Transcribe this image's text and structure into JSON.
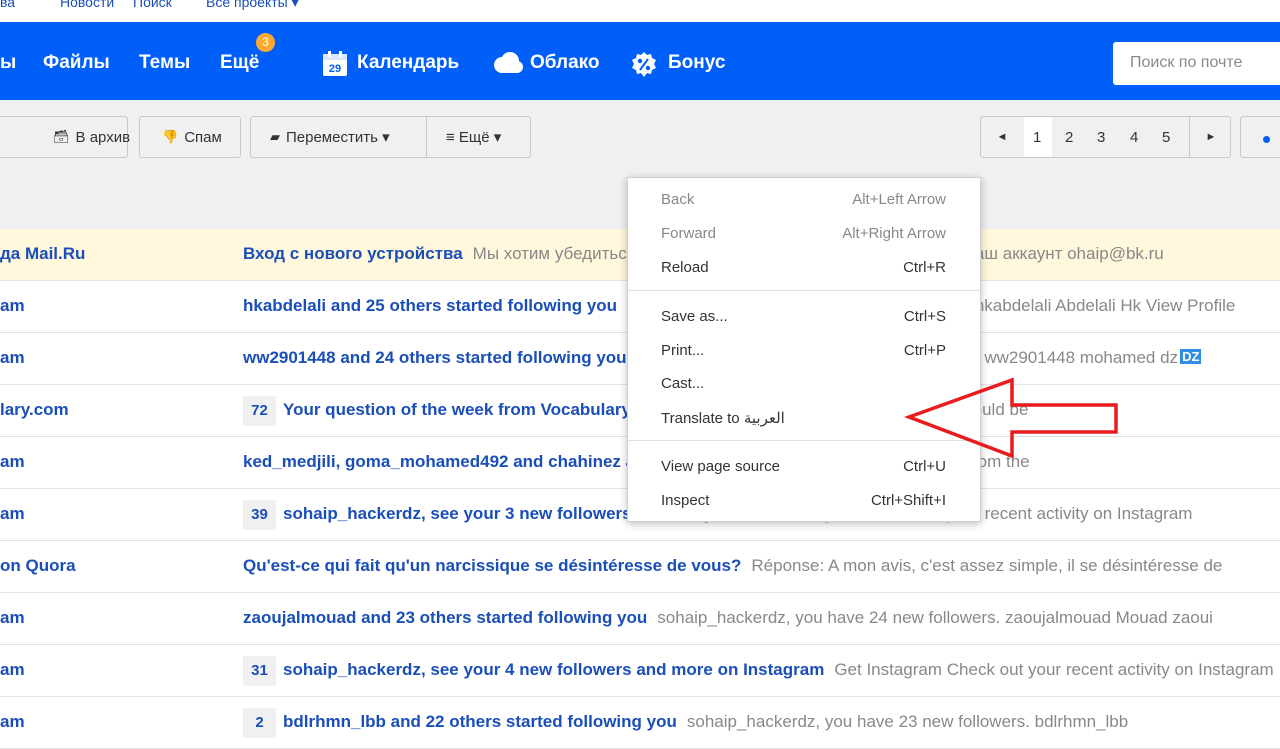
{
  "portal": {
    "items": [
      "ва",
      "Новости",
      "Поиск",
      "Все проекты ▾"
    ]
  },
  "header": {
    "nav": [
      "ы",
      "Файлы",
      "Темы",
      "Ещё"
    ],
    "more_badge": "3",
    "calendar_day": "29",
    "calendar": "Календарь",
    "cloud": "Облако",
    "bonus": "Бонус",
    "search_placeholder": "Поиск по почте",
    "colors": {
      "header_bg": "#005ff9",
      "badge": "#ffa930"
    }
  },
  "toolbar": {
    "archive": "В архив",
    "spam": "Спам",
    "move": "Переместить ▾",
    "more": "≡ Ещё ▾",
    "pages": [
      "1",
      "2",
      "3",
      "4",
      "5"
    ],
    "current_page": "1",
    "prev_icon": "◄",
    "next_icon": "►"
  },
  "messages": [
    {
      "sender": "да Mail.Ru",
      "count": "",
      "subject": "Вход с нового устройства",
      "snippet": "Мы хотим убедиться, что вы в безопасности. Здравствуйте! В ваш аккаунт ohaip@bk.ru",
      "unread_highlight": true
    },
    {
      "sender": "am",
      "count": "",
      "subject": "hkabdelali and 25 others started following you",
      "snippet": "sohaip_hackerdz, you have 25 new followers. hkabdelali Abdelali Hk View Profile"
    },
    {
      "sender": "am",
      "count": "",
      "subject": "ww2901448 and 24 others started following you",
      "snippet": "sohaip_hackerdz, you have 24 new followers. ww2901448 mohamed dz",
      "badge": "DZ"
    },
    {
      "sender": "lary.com",
      "count": "72",
      "subject": "Your question of the week from Vocabulary.com",
      "snippet": "Your question of the week: Yes, there could be"
    },
    {
      "sender": "am",
      "count": "",
      "subject": "ked_medjili, goma_mohamed492 and chahinez and others",
      "snippet": "See what you may have missed from the"
    },
    {
      "sender": "am",
      "count": "39",
      "subject": "sohaip_hackerdz, see your 3 new followers on Instagram",
      "snippet": "Get Instagram Check out your recent activity on Instagram"
    },
    {
      "sender": "on Quora",
      "count": "",
      "subject": "Qu'est-ce qui fait qu'un narcissique se désintéresse de vous?",
      "snippet": "Réponse: A mon avis, c'est assez simple, il se désintéresse de"
    },
    {
      "sender": "am",
      "count": "",
      "subject": "zaoujalmouad and 23 others started following you",
      "snippet": "sohaip_hackerdz, you have 24 new followers. zaoujalmouad Mouad zaoui"
    },
    {
      "sender": "am",
      "count": "31",
      "subject": "sohaip_hackerdz, see your 4 new followers and more on Instagram",
      "snippet": "Get Instagram Check out your recent activity on Instagram"
    },
    {
      "sender": "am",
      "count": "2",
      "subject": "bdlrhmn_lbb and 22 others started following you",
      "snippet": "sohaip_hackerdz, you have 23 new followers. bdlrhmn_lbb"
    }
  ],
  "context_menu": {
    "items": [
      {
        "label": "Back",
        "shortcut": "Alt+Left Arrow",
        "disabled": true
      },
      {
        "label": "Forward",
        "shortcut": "Alt+Right Arrow",
        "disabled": true
      },
      {
        "label": "Reload",
        "shortcut": "Ctrl+R"
      },
      {
        "label": "Save as...",
        "shortcut": "Ctrl+S"
      },
      {
        "label": "Print...",
        "shortcut": "Ctrl+P"
      },
      {
        "label": "Cast...",
        "shortcut": ""
      },
      {
        "label": "Translate to العربية",
        "shortcut": ""
      },
      {
        "label": "View page source",
        "shortcut": "Ctrl+U"
      },
      {
        "label": "Inspect",
        "shortcut": "Ctrl+Shift+I"
      }
    ]
  },
  "annotation": {
    "arrow_color": "#e81c1c",
    "arrow_icon": "red-outline-arrow-icon"
  }
}
